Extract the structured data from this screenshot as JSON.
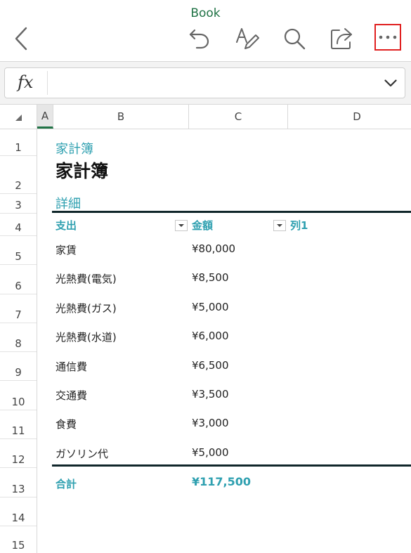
{
  "toolbar": {
    "title": "Book",
    "accent_color": "#217346",
    "icons": [
      "back-chevron-icon",
      "undo-icon",
      "draw-icon",
      "search-icon",
      "share-icon",
      "more-icon"
    ]
  },
  "formula_bar": {
    "fx_label": "fx",
    "value": ""
  },
  "columns": [
    "A",
    "B",
    "C",
    "D"
  ],
  "selected_column": "A",
  "rows": [
    "1",
    "2",
    "3",
    "4",
    "5",
    "6",
    "7",
    "8",
    "9",
    "10",
    "11",
    "12",
    "13",
    "14",
    "15"
  ],
  "sheet": {
    "subtitle": "家計簿",
    "title": "家計簿",
    "section": "詳細",
    "headers": [
      "支出",
      "金額",
      "列1"
    ],
    "items": [
      {
        "label": "家賃",
        "amount": "¥80,000"
      },
      {
        "label": "光熱費(電気)",
        "amount": "¥8,500"
      },
      {
        "label": "光熱費(ガス)",
        "amount": "¥5,000"
      },
      {
        "label": "光熱費(水道)",
        "amount": "¥6,000"
      },
      {
        "label": "通信費",
        "amount": "¥6,500"
      },
      {
        "label": "交通費",
        "amount": "¥3,500"
      },
      {
        "label": "食費",
        "amount": "¥3,000"
      },
      {
        "label": "ガソリン代",
        "amount": "¥5,000"
      }
    ],
    "total_label": "合計",
    "total_amount": "¥117,500",
    "accent_color": "#2fa0b0"
  }
}
